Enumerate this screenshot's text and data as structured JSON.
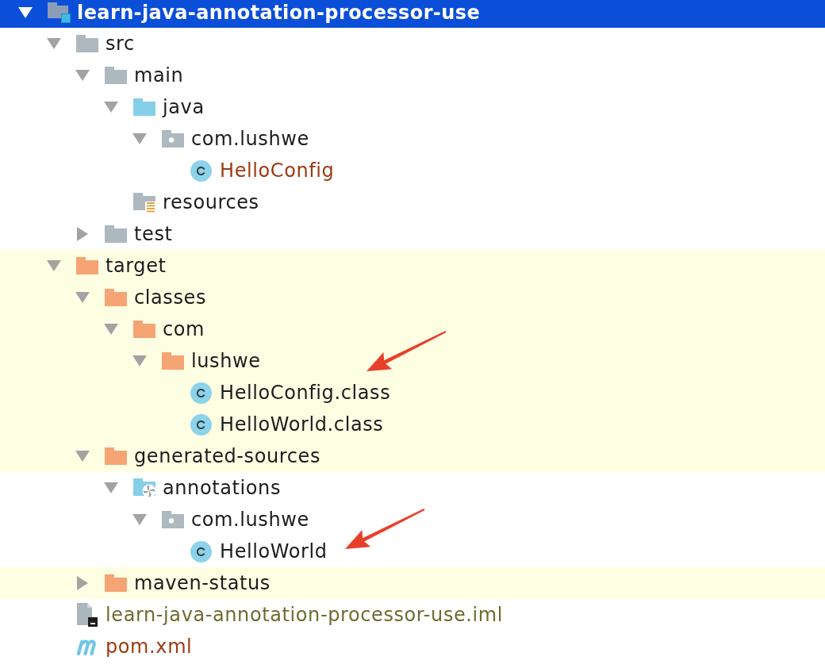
{
  "project_tree": [
    {
      "label": "learn-java-annotation-processor-use",
      "kind": "module",
      "expanded": true,
      "selected": true,
      "marked": false,
      "children": [
        {
          "label": "src",
          "kind": "folder",
          "expanded": true,
          "selected": false,
          "highlighted": false,
          "marked": false,
          "children": [
            {
              "label": "main",
              "kind": "folder",
              "expanded": true,
              "selected": false,
              "highlighted": false,
              "marked": false,
              "children": [
                {
                  "label": "java",
                  "kind": "source-root",
                  "expanded": true,
                  "selected": false,
                  "highlighted": false,
                  "marked": false,
                  "children": [
                    {
                      "label": "com.lushwe",
                      "kind": "package",
                      "expanded": true,
                      "selected": false,
                      "highlighted": false,
                      "marked": false,
                      "children": [
                        {
                          "label": "HelloConfig",
                          "kind": "class",
                          "color": "#9b3a11",
                          "selected": false,
                          "highlighted": false,
                          "marked": false
                        }
                      ]
                    }
                  ]
                },
                {
                  "label": "resources",
                  "kind": "resources-root",
                  "selected": false,
                  "highlighted": false,
                  "marked": false
                }
              ]
            },
            {
              "label": "test",
              "kind": "folder",
              "expanded": false,
              "selected": false,
              "highlighted": false,
              "marked": false
            }
          ]
        },
        {
          "label": "target",
          "kind": "excluded-folder",
          "expanded": true,
          "selected": false,
          "highlighted": true,
          "marked": false,
          "children": [
            {
              "label": "classes",
              "kind": "excluded-folder",
              "expanded": true,
              "selected": false,
              "highlighted": true,
              "marked": false,
              "children": [
                {
                  "label": "com",
                  "kind": "excluded-folder",
                  "expanded": true,
                  "selected": false,
                  "highlighted": true,
                  "marked": false,
                  "children": [
                    {
                      "label": "lushwe",
                      "kind": "excluded-folder",
                      "expanded": true,
                      "selected": false,
                      "highlighted": true,
                      "marked": false,
                      "children": [
                        {
                          "label": "HelloConfig.class",
                          "kind": "class",
                          "selected": false,
                          "highlighted": true,
                          "marked": true
                        },
                        {
                          "label": "HelloWorld.class",
                          "kind": "class",
                          "selected": false,
                          "highlighted": true,
                          "marked": false
                        }
                      ]
                    }
                  ]
                }
              ]
            },
            {
              "label": "generated-sources",
              "kind": "excluded-folder",
              "expanded": true,
              "selected": false,
              "highlighted": true,
              "marked": false,
              "children": [
                {
                  "label": "annotations",
                  "kind": "generated-root",
                  "expanded": true,
                  "selected": false,
                  "highlighted": false,
                  "marked": false,
                  "children": [
                    {
                      "label": "com.lushwe",
                      "kind": "package",
                      "expanded": true,
                      "selected": false,
                      "highlighted": false,
                      "marked": false,
                      "children": [
                        {
                          "label": "HelloWorld",
                          "kind": "class",
                          "selected": false,
                          "highlighted": false,
                          "marked": true
                        }
                      ]
                    }
                  ]
                }
              ]
            },
            {
              "label": "maven-status",
              "kind": "excluded-folder",
              "expanded": false,
              "selected": false,
              "highlighted": true,
              "marked": false
            }
          ]
        },
        {
          "label": "learn-java-annotation-processor-use.iml",
          "kind": "iml-file",
          "color": "#6e6c2f",
          "selected": false,
          "highlighted": false,
          "marked": false
        },
        {
          "label": "pom.xml",
          "kind": "maven-pom",
          "color": "#9b3a11",
          "selected": false,
          "highlighted": false,
          "marked": false
        }
      ]
    }
  ]
}
